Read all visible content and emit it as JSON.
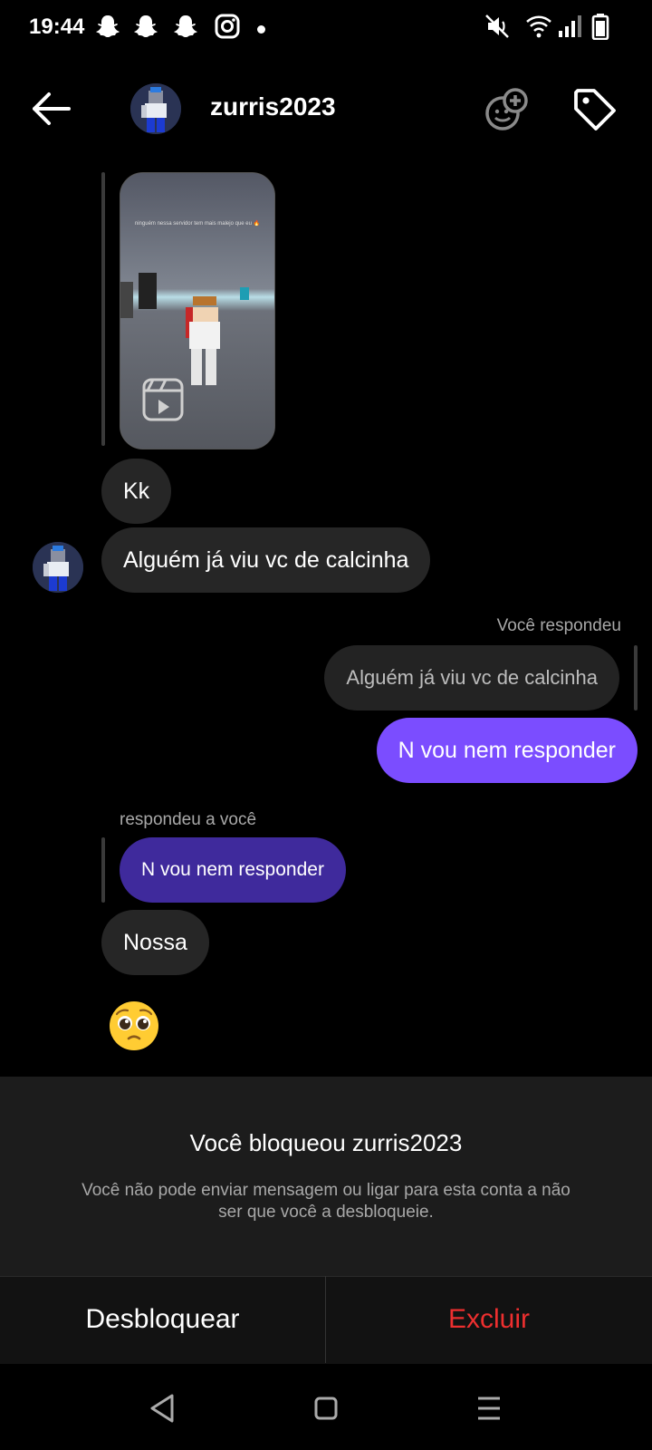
{
  "status_bar": {
    "time": "19:44",
    "left_icons": [
      "snapchat-icon",
      "snapchat-icon",
      "snapchat-icon",
      "instagram-icon",
      "notification-dot"
    ],
    "right_icons": [
      "mute-icon",
      "wifi-icon",
      "signal-icon",
      "battery-icon"
    ]
  },
  "header": {
    "username": "zurris2023",
    "back_icon": "arrow-left-icon",
    "effects_icon": "face-add-icon",
    "tag_icon": "tag-icon"
  },
  "messages": {
    "reel_caption": "ninguém nessa servidor tem mais malejo que eu 🔥",
    "kk": "Kk",
    "question": "Alguém já viu vc de calcinha",
    "you_replied_label": "Você respondeu",
    "quoted_question": "Alguém já viu vc de calcinha",
    "my_reply": "N vou nem responder",
    "replied_to_you_label": "respondeu a você",
    "quoted_my_reply": "N vou nem responder",
    "nossa": "Nossa",
    "emoji": "🥺"
  },
  "blocked": {
    "title": "Você bloqueou zurris2023",
    "description": "Você não pode enviar mensagem ou ligar para esta conta a não ser que você a desbloqueie.",
    "unblock_label": "Desbloquear",
    "delete_label": "Excluir"
  },
  "colors": {
    "accent_purple": "#7b4dff",
    "quoted_purple": "#3f2a9c",
    "delete_red": "#ed2f2f"
  },
  "nav_bar": [
    "back-triangle-icon",
    "home-square-icon",
    "menu-lines-icon"
  ]
}
